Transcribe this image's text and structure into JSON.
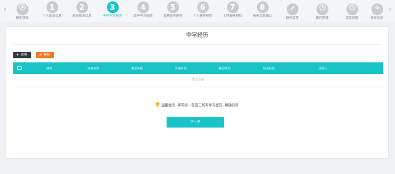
{
  "stepbar": {
    "steps": [
      {
        "num": "",
        "icon": "target-icon",
        "label": "报名须知"
      },
      {
        "num": "1",
        "label": "个人基本信息"
      },
      {
        "num": "2",
        "label": "家长基本信息"
      },
      {
        "num": "3",
        "label": "中学学习经历"
      },
      {
        "num": "4",
        "label": "高中学习成绩"
      },
      {
        "num": "5",
        "label": "竞赛及奖获奖"
      },
      {
        "num": "6",
        "label": "个人获奖经历"
      },
      {
        "num": "7",
        "label": "上传报名材料"
      },
      {
        "num": "8",
        "label": "报名信息确认"
      },
      {
        "num": "",
        "icon": "pen-icon",
        "label": "报名自荐"
      },
      {
        "num": "",
        "icon": "clock-icon",
        "label": "操作完成"
      },
      {
        "num": "",
        "icon": "question-icon",
        "label": "常见问题"
      },
      {
        "num": "",
        "icon": "gear-icon",
        "label": "账号信息"
      }
    ],
    "active_index": 3,
    "active_color": "#19c3c7",
    "inactive_color": "#c8cbd0"
  },
  "page": {
    "title": "中学经历",
    "add_label": "新增",
    "delete_label": "删除",
    "add_color": "#333a42",
    "delete_color": "#f57c1f"
  },
  "table": {
    "headers": [
      "操作",
      "学校名称",
      "就读年级",
      "开始时间",
      "截至时间",
      "担任职务",
      "证明人"
    ],
    "empty_text": "暂无记录",
    "header_color": "#19c3c7"
  },
  "tip": {
    "text": "温馨提示: 填写初一至高三所有学习经历, 精确到月",
    "icon": "lightbulb-icon"
  },
  "next": {
    "label": "下一步"
  }
}
